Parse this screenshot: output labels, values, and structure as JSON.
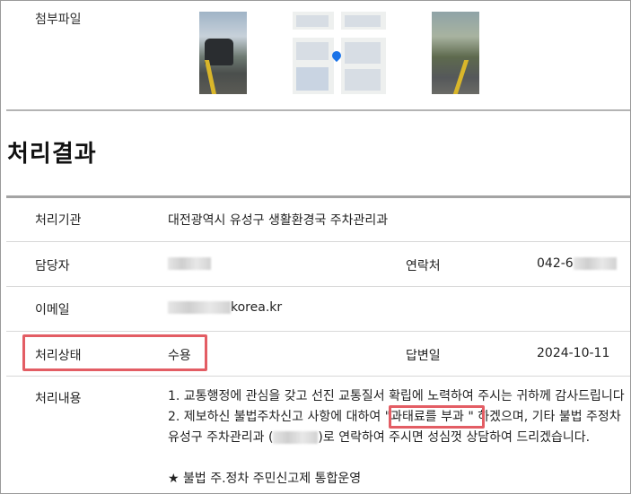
{
  "attachments": {
    "label": "첨부파일",
    "images": [
      {
        "name": "photo-1",
        "icon": "street-photo-icon"
      },
      {
        "name": "map",
        "icon": "map-icon"
      },
      {
        "name": "photo-2",
        "icon": "street-photo-icon"
      }
    ]
  },
  "result": {
    "title": "처리결과",
    "agency_label": "처리기관",
    "agency_value": "대전광역시 유성구 생활환경국 주차관리과",
    "manager_label": "담당자",
    "contact_label": "연락처",
    "contact_value_prefix": "042-6",
    "email_label": "이메일",
    "email_suffix": "korea.kr",
    "status_label": "처리상태",
    "status_value": "수용",
    "reply_date_label": "답변일",
    "reply_date_value": "2024-10-11",
    "content_label": "처리내용",
    "content": {
      "line1": "1. 교통행정에 관심을 갖고 선진 교통질서 확립에 노력하여 주시는 귀하께 감사드립니다",
      "line2_a": "2. 제보하신 불법주차신고 사항에 대하여 \"",
      "line2_b": "과태료를 부과 \"",
      "line2_c": " 하겠으며, 기타 불법 주정차",
      "line3_a": "유성구 주차관리과 (",
      "line3_b": ")로 연락하여 주시면 성심껏 상담하여 드리겠습니다.",
      "line5": "★ 불법 주.정차 주민신고제 통합운영"
    }
  },
  "colors": {
    "highlight": "#e35d64",
    "rule": "#a4a4a4"
  }
}
